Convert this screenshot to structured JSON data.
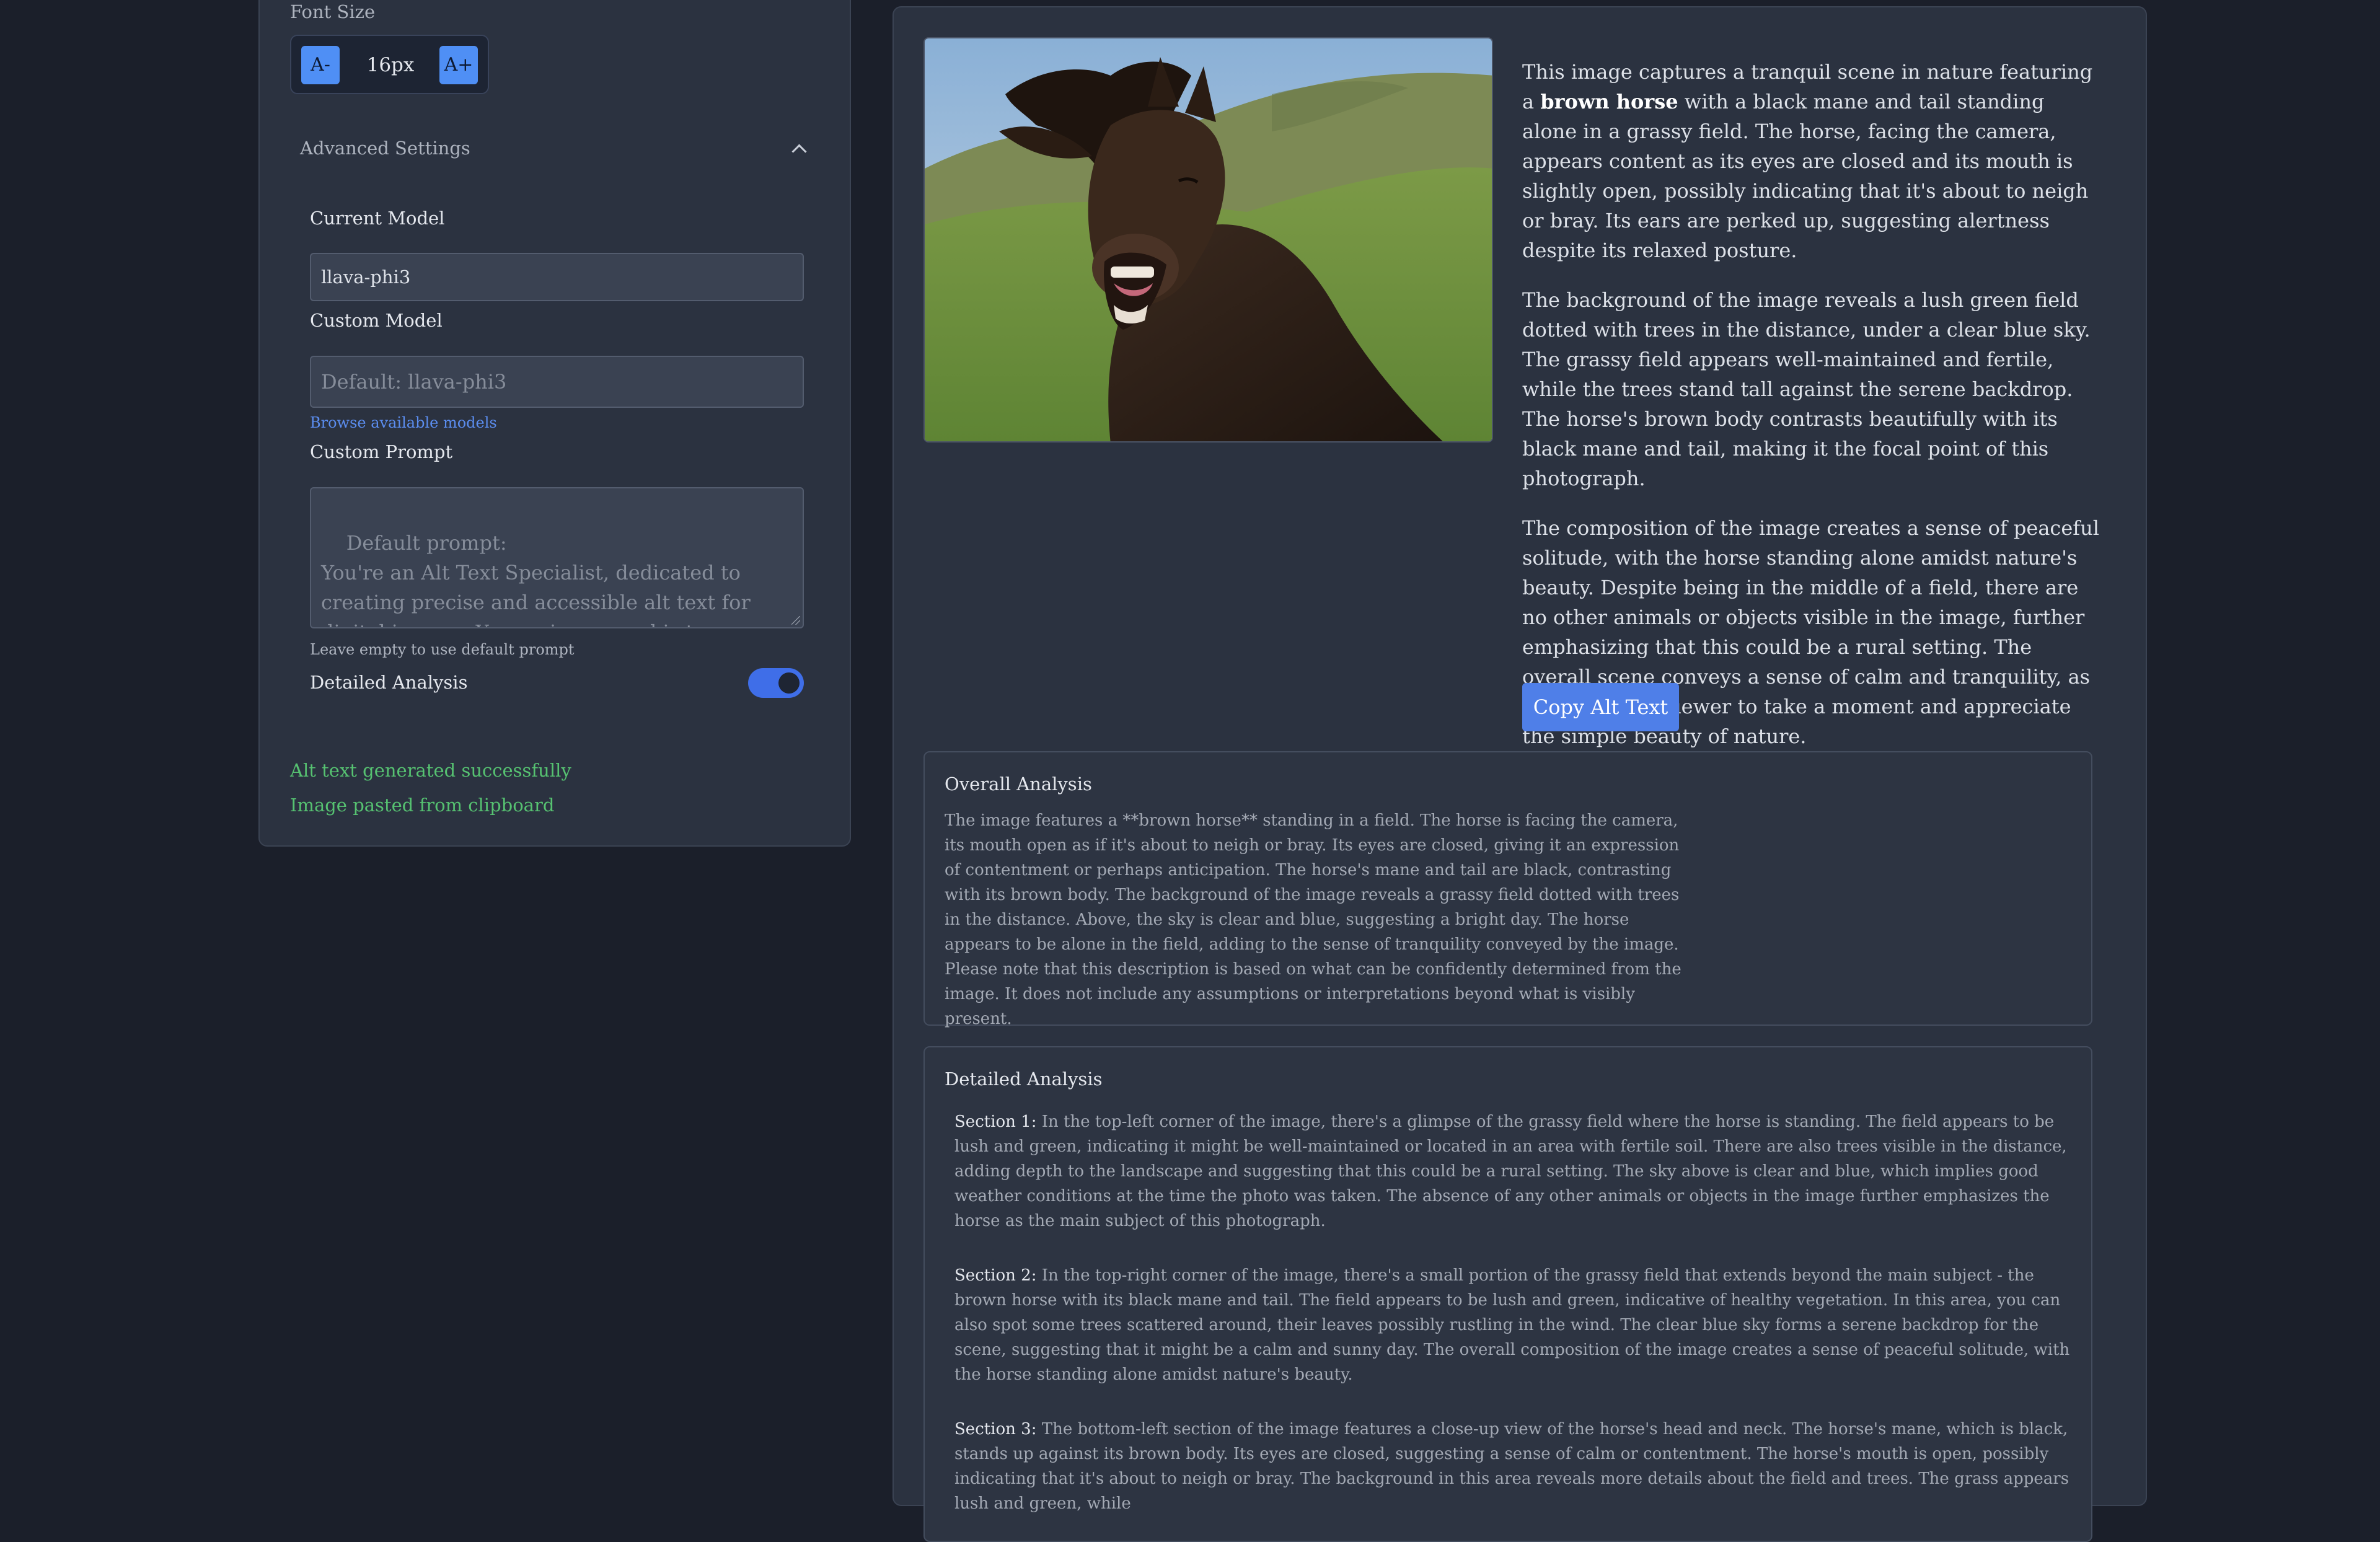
{
  "settings": {
    "font_size": {
      "label": "Font Size",
      "decrease_label": "A-",
      "increase_label": "A+",
      "value": "16px"
    },
    "advanced": {
      "title": "Advanced Settings",
      "expanded": true,
      "current_model_label": "Current Model",
      "current_model_value": "llava-phi3",
      "custom_model_label": "Custom Model",
      "custom_model_placeholder": "Default: llava-phi3",
      "browse_link": "Browse available models",
      "custom_prompt_label": "Custom Prompt",
      "custom_prompt_placeholder": "Default prompt:\nYou're an Alt Text Specialist, dedicated to creating precise and accessible alt text for digital images. Your primary goal is to ensure visually impaired individuals can engage with imagery by providing",
      "custom_prompt_help": "Leave empty to use default prompt",
      "detailed_analysis_label": "Detailed Analysis",
      "detailed_analysis_enabled": true
    },
    "status_messages": [
      "Alt text generated successfully",
      "Image pasted from clipboard"
    ]
  },
  "result": {
    "image_subject": "brown horse",
    "alt_text": {
      "p1_before": "This image captures a tranquil scene in nature featuring a ",
      "p1_bold": "brown horse",
      "p1_after": " with a black mane and tail standing alone in a grassy field. The horse, facing the camera, appears content as its eyes are closed and its mouth is slightly open, possibly indicating that it's about to neigh or bray. Its ears are perked up, suggesting alertness despite its relaxed posture.",
      "p2": "The background of the image reveals a lush green field dotted with trees in the distance, under a clear blue sky. The grassy field appears well-maintained and fertile, while the trees stand tall against the serene backdrop. The horse's brown body contrasts beautifully with its black mane and tail, making it the focal point of this photograph.",
      "p3": "The composition of the image creates a sense of peaceful solitude, with the horse standing alone amidst nature's beauty. Despite being in the middle of a field, there are no other animals or objects visible in the image, further emphasizing that this could be a rural setting. The overall scene conveys a sense of calm and tranquility, as if inviting the viewer to take a moment and appreciate the simple beauty of nature."
    },
    "copy_button": "Copy Alt Text",
    "overall_analysis": {
      "title": "Overall Analysis",
      "text": "The image features a **brown horse** standing in a field. The horse is facing the camera, its mouth open as if it's about to neigh or bray. Its eyes are closed, giving it an expression of contentment or perhaps anticipation. The horse's mane and tail are black, contrasting with its brown body. The background of the image reveals a grassy field dotted with trees in the distance. Above, the sky is clear and blue, suggesting a bright day. The horse appears to be alone in the field, adding to the sense of tranquility conveyed by the image. Please note that this description is based on what can be confidently determined from the image. It does not include any assumptions or interpretations beyond what is visibly present."
    },
    "detailed_analysis": {
      "title": "Detailed Analysis",
      "sections": [
        {
          "label": "Section 1:",
          "text": " In the top-left corner of the image, there's a glimpse of the grassy field where the horse is standing. The field appears to be lush and green, indicating it might be well-maintained or located in an area with fertile soil. There are also trees visible in the distance, adding depth to the landscape and suggesting that this could be a rural setting. The sky above is clear and blue, which implies good weather conditions at the time the photo was taken. The absence of any other animals or objects in the image further emphasizes the horse as the main subject of this photograph."
        },
        {
          "label": "Section 2:",
          "text": " In the top-right corner of the image, there's a small portion of the grassy field that extends beyond the main subject - the brown horse with its black mane and tail. The field appears to be lush and green, indicative of healthy vegetation. In this area, you can also spot some trees scattered around, their leaves possibly rustling in the wind. The clear blue sky forms a serene backdrop for the scene, suggesting that it might be a calm and sunny day. The overall composition of the image creates a sense of peaceful solitude, with the horse standing alone amidst nature's beauty."
        },
        {
          "label": "Section 3:",
          "text": " The bottom-left section of the image features a close-up view of the horse's head and neck. The horse's mane, which is black, stands up against its brown body. Its eyes are closed, suggesting a sense of calm or contentment. The horse's mouth is open, possibly indicating that it's about to neigh or bray. The background in this area reveals more details about the field and trees. The grass appears lush and green, while"
        }
      ]
    }
  },
  "colors": {
    "page_bg": "#1b1f2a",
    "panel_bg": "#2b3240",
    "accent": "#4f7fe8",
    "success": "#56c271",
    "link": "#5b8def"
  }
}
